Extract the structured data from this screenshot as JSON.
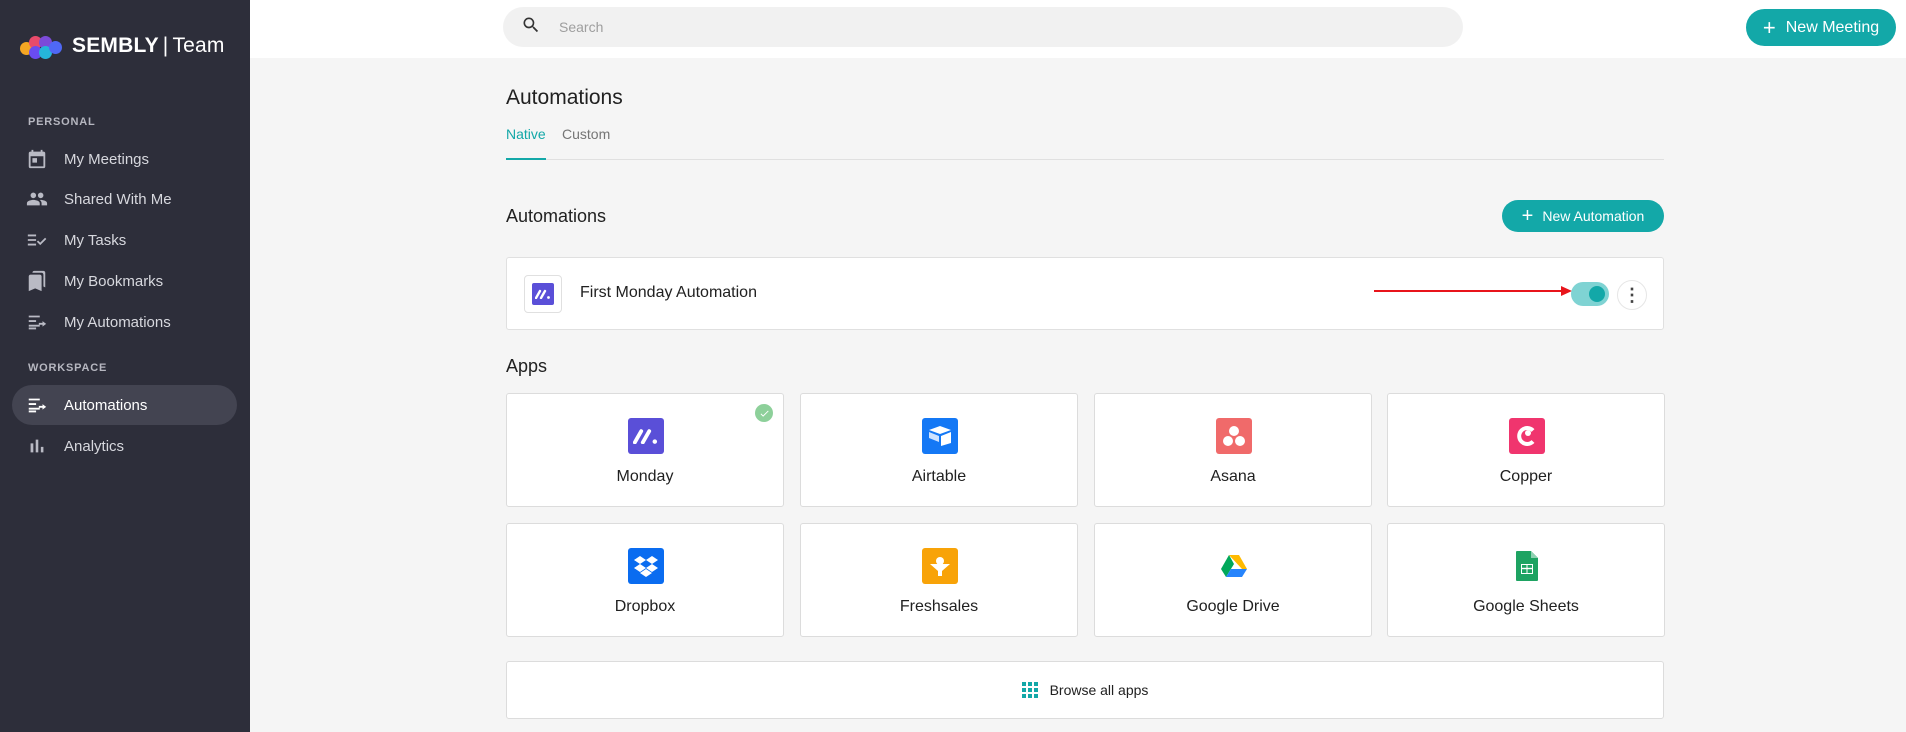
{
  "brand": {
    "name": "SEMBLY",
    "plan": "Team"
  },
  "sidebar": {
    "personal_label": "PERSONAL",
    "workspace_label": "WORKSPACE",
    "personal_items": [
      {
        "label": "My Meetings",
        "icon": "calendar-icon"
      },
      {
        "label": "Shared With Me",
        "icon": "people-icon"
      },
      {
        "label": "My Tasks",
        "icon": "checklist-icon"
      },
      {
        "label": "My Bookmarks",
        "icon": "bookmark-icon"
      },
      {
        "label": "My Automations",
        "icon": "automation-icon"
      }
    ],
    "workspace_items": [
      {
        "label": "Automations",
        "icon": "automation-icon",
        "active": true
      },
      {
        "label": "Analytics",
        "icon": "bar-chart-icon"
      }
    ]
  },
  "header": {
    "search_placeholder": "Search",
    "new_meeting_label": "New Meeting",
    "accent_color": "#13a8a8"
  },
  "main": {
    "title": "Automations",
    "tabs": [
      {
        "label": "Native",
        "active": true
      },
      {
        "label": "Custom",
        "active": false
      }
    ],
    "automations_section": {
      "title": "Automations",
      "new_button_label": "New Automation",
      "items": [
        {
          "name": "First Monday Automation",
          "app": "Monday",
          "enabled": true
        }
      ]
    },
    "apps_section": {
      "title": "Apps",
      "apps": [
        {
          "name": "Monday",
          "icon": "monday-icon",
          "color": "#5a4fd8",
          "connected": true
        },
        {
          "name": "Airtable",
          "icon": "airtable-icon",
          "color": "#1478f5",
          "connected": false
        },
        {
          "name": "Asana",
          "icon": "asana-icon",
          "color": "#f06a6a",
          "connected": false
        },
        {
          "name": "Copper",
          "icon": "copper-icon",
          "color": "#f0356e",
          "connected": false
        },
        {
          "name": "Dropbox",
          "icon": "dropbox-icon",
          "color": "#0a6cf0",
          "connected": false
        },
        {
          "name": "Freshsales",
          "icon": "freshsales-icon",
          "color": "#f8a308",
          "connected": false
        },
        {
          "name": "Google Drive",
          "icon": "google-drive-icon",
          "color": "#ffffff",
          "connected": false
        },
        {
          "name": "Google Sheets",
          "icon": "google-sheets-icon",
          "color": "#ffffff",
          "connected": false
        }
      ],
      "browse_label": "Browse all apps"
    }
  }
}
